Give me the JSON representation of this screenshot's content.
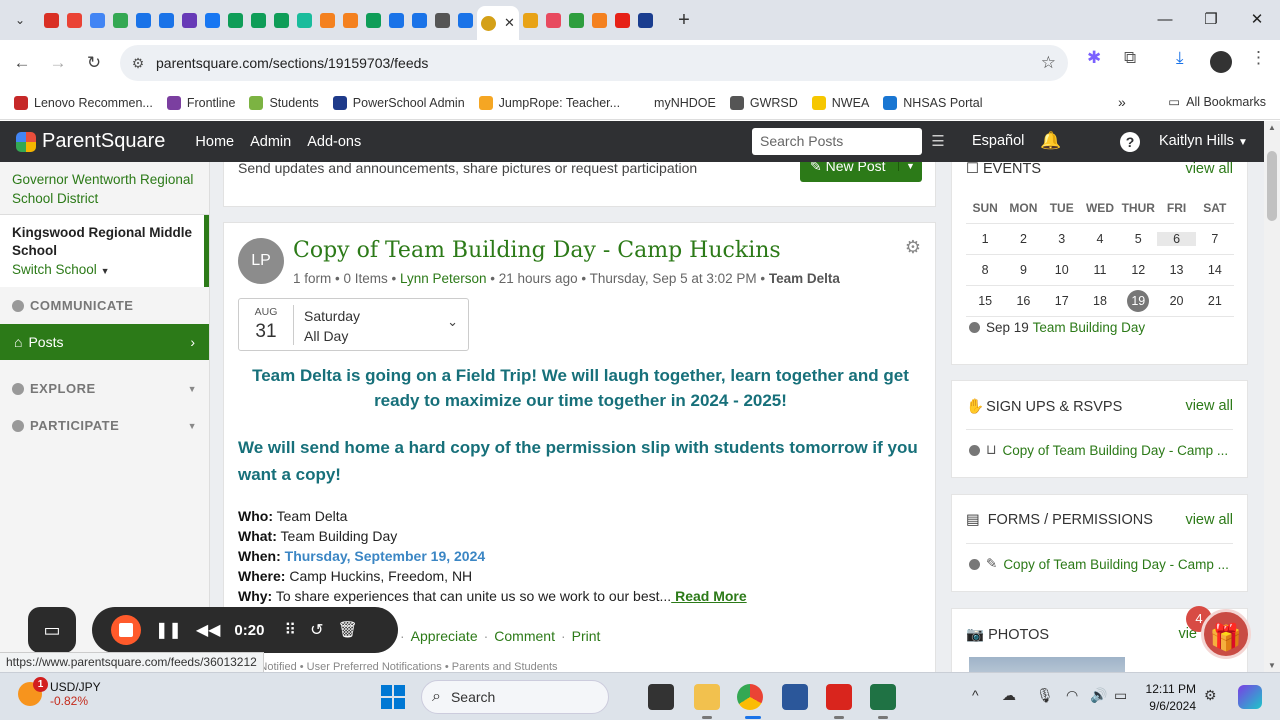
{
  "browser": {
    "tab_icon_colors": [
      "#d93025",
      "#ea4335",
      "#4285f4",
      "#34a853",
      "#1a73e8",
      "#1a73e8",
      "#673ab7",
      "#1877f2",
      "#0f9d58",
      "#0f9d58",
      "#0f9d58",
      "#1abc9c",
      "#f4811f",
      "#f4811f",
      "#0f9d58",
      "#1a73e8",
      "#1a73e8",
      "#555555",
      "#1a73e8",
      "#d4a017",
      "#e8a317",
      "#e84a5f",
      "#2e9e3e",
      "#f4811f",
      "#e62117",
      "#1a3d8f"
    ],
    "url": "parentsquare.com/sections/19159703/feeds",
    "bookmarks": [
      {
        "label": "Lenovo Recommen...",
        "color": "#c62828"
      },
      {
        "label": "Frontline",
        "color": "#7b3fa0"
      },
      {
        "label": "Students",
        "color": "#7cb342"
      },
      {
        "label": "PowerSchool Admin",
        "color": "#1e3a8a"
      },
      {
        "label": "JumpRope: Teacher...",
        "color": "#f5a623"
      },
      {
        "label": "myNHDOE",
        "color": "#ffffff"
      },
      {
        "label": "GWRSD",
        "color": "#555555"
      },
      {
        "label": "NWEA",
        "color": "#f6c700"
      },
      {
        "label": "NHSAS Portal",
        "color": "#1976d2"
      }
    ],
    "all_bookmarks": "All Bookmarks"
  },
  "psnav": {
    "brand": "ParentSquare",
    "links": [
      "Home",
      "Admin",
      "Add-ons"
    ],
    "search_placeholder": "Search Posts",
    "language": "Español",
    "user": "Kaitlyn Hills"
  },
  "sidebar": {
    "district": "Governor Wentworth Regional School District",
    "school": "Kingswood Regional Middle School",
    "switch_school": "Switch School",
    "communicate": "COMMUNICATE",
    "posts": "Posts",
    "explore": "EXPLORE",
    "participate": "PARTICIPATE"
  },
  "intro": {
    "text": "Send updates and announcements, share pictures or request participation",
    "new_post": "New Post"
  },
  "post": {
    "avatar": "LP",
    "title": "Copy of Team Building Day - Camp Huckins",
    "meta_prefix": "1 form • 0 Items • ",
    "author": "Lynn Peterson",
    "meta_time": " • 21 hours ago • Thursday, Sep 5 at 3:02 PM • ",
    "group": "Team Delta",
    "date_month": "AUG",
    "date_day": "31",
    "date_weekday": "Saturday",
    "date_allday": "All Day",
    "headline1": "Team Delta is going on a Field Trip! We will laugh together, learn together and get ready to maximize our time together in 2024 - 2025!",
    "headline2": "We will send home a hard copy of the permission slip with students tomorrow if you want a copy!",
    "who_label": "Who:",
    "who": " Team Delta",
    "what_label": "What:",
    "what": " Team Building Day",
    "when_label": "When:",
    "when": "Thursday, September 19, 2024",
    "where_label": "Where:",
    "where": " Camp Huckins, Freedom, NH",
    "why_label": "Why:",
    "why": " To share experiences that can unite us so we work to our best...",
    "read_more": " Read More",
    "actions": [
      "Appreciate",
      "Comment",
      "Print"
    ],
    "notified": "247 Notified • User Preferred Notifications • Parents and Students"
  },
  "events": {
    "title": "EVENTS",
    "view_all": "view all",
    "days": [
      "SUN",
      "MON",
      "TUE",
      "WED",
      "THUR",
      "FRI",
      "SAT"
    ],
    "weeks": [
      [
        "1",
        "2",
        "3",
        "4",
        "5",
        "6",
        "7"
      ],
      [
        "8",
        "9",
        "10",
        "11",
        "12",
        "13",
        "14"
      ],
      [
        "15",
        "16",
        "17",
        "18",
        "19",
        "20",
        "21"
      ]
    ],
    "item_date": "Sep 19",
    "item_label": "Team Building Day"
  },
  "signups": {
    "title": "SIGN UPS & RSVPS",
    "view_all": "view all",
    "item": "Copy of Team Building Day - Camp ..."
  },
  "forms": {
    "title": "FORMS / PERMISSIONS",
    "view_all": "view all",
    "item": "Copy of Team Building Day - Camp ..."
  },
  "photos": {
    "title": "PHOTOS",
    "view_all": "vie",
    "badge": "4"
  },
  "recorder": {
    "time": "0:20"
  },
  "status_url": "https://www.parentsquare.com/feeds/36013212",
  "taskbar": {
    "stock_name": "USD/JPY",
    "stock_change": "-0.82%",
    "stock_badge": "1",
    "search": "Search",
    "time": "12:11 PM",
    "date": "9/6/2024"
  }
}
